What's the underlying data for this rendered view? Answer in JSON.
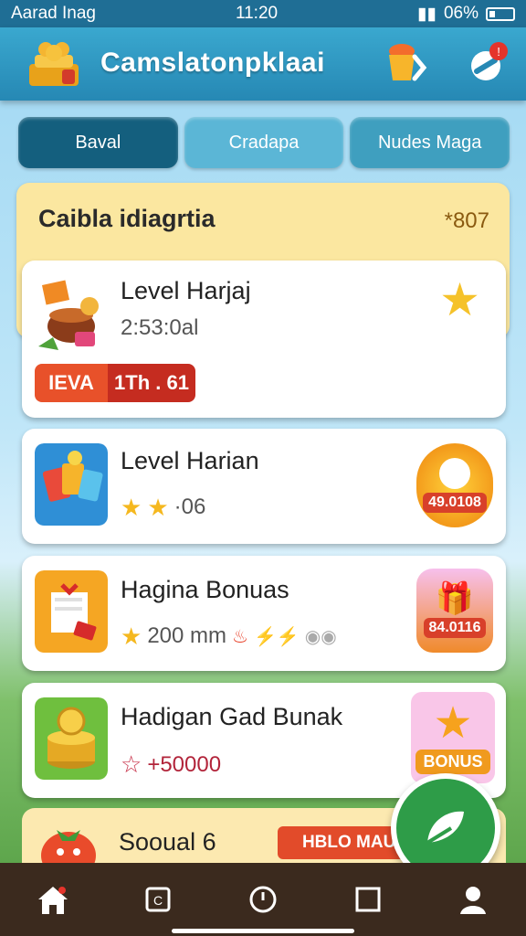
{
  "status_bar": {
    "carrier": "Aarad Inag",
    "time": "11:20",
    "battery": "06%"
  },
  "header": {
    "title": "Camslatonpklaai"
  },
  "tabs": [
    {
      "label": "Baval",
      "active": true
    },
    {
      "label": "Cradapa",
      "active": false
    },
    {
      "label": "Nudes Maga",
      "active": false
    }
  ],
  "panel": {
    "title": "Caibla idiagrtia",
    "value": "*807"
  },
  "cards": [
    {
      "title": "Level Harjaj",
      "subtitle": "2:53:0al",
      "badge_left": "IEVA",
      "badge_right": "1Th . 61",
      "icon": "star-icon"
    },
    {
      "title": "Level Harian",
      "subtitle": "·06",
      "seal_value": "49.0108",
      "icon": "sun-seal-icon"
    },
    {
      "title": "Hagina Bonuas",
      "subtitle": "200 mm",
      "seal_value": "84.0116",
      "icon": "gift-seal-icon"
    },
    {
      "title": "Hadigan Gad Bunak",
      "subtitle": "+50000",
      "bonus_label": "BONUS",
      "icon": "star-face-icon"
    }
  ],
  "bottom_card": {
    "title": "Sooual 6",
    "ribbon": "HBLO MAUH"
  },
  "nav": [
    "home-icon",
    "copy-icon",
    "clock-icon",
    "square-icon",
    "profile-icon"
  ],
  "colors": {
    "header": "#2688b4",
    "active_tab": "#145f7e",
    "panel": "#fbe7a0",
    "fab": "#2e9c48",
    "nav": "#3b2a1e"
  }
}
